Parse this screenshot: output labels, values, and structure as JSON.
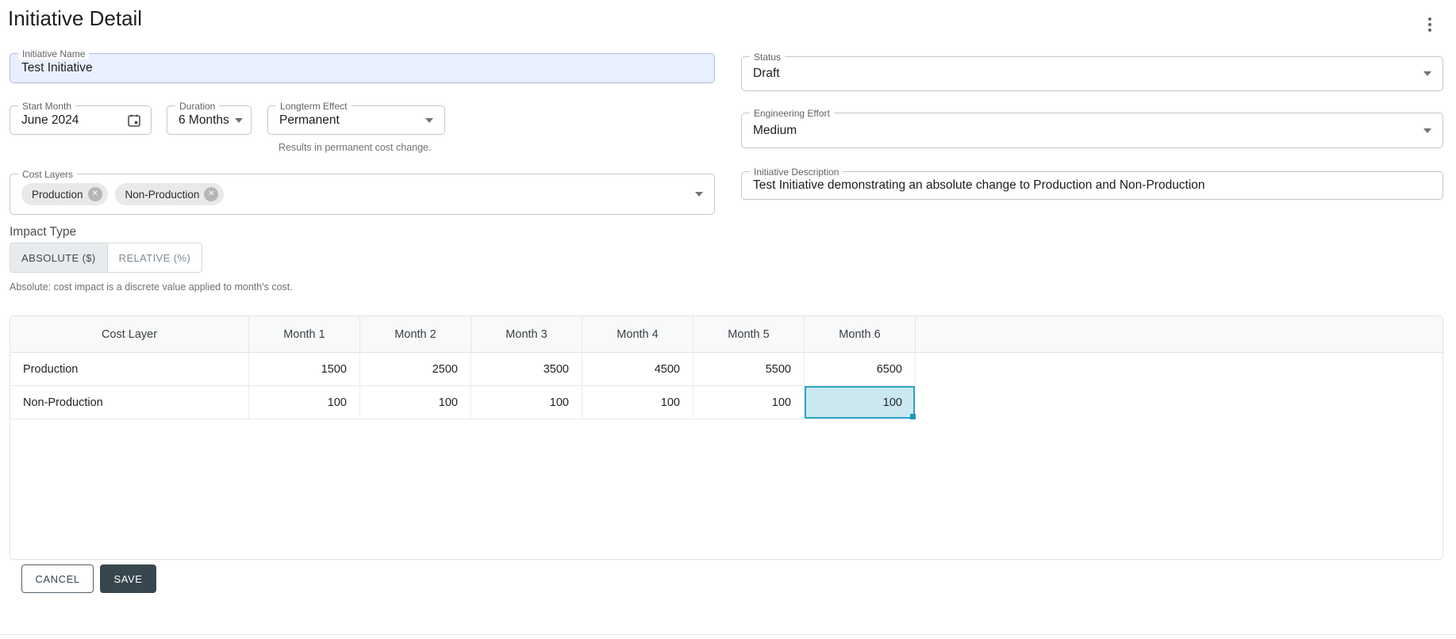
{
  "header": {
    "title": "Initiative Detail"
  },
  "fields": {
    "initiative_name": {
      "label": "Initiative Name",
      "value": "Test Initiative"
    },
    "status": {
      "label": "Status",
      "value": "Draft"
    },
    "start_month": {
      "label": "Start Month",
      "value": "June 2024"
    },
    "duration": {
      "label": "Duration",
      "value": "6 Months"
    },
    "longterm_effect": {
      "label": "Longterm Effect",
      "value": "Permanent",
      "helper": "Results in permanent cost change."
    },
    "engineering_effort": {
      "label": "Engineering Effort",
      "value": "Medium"
    },
    "cost_layers": {
      "label": "Cost Layers",
      "chips": [
        {
          "label": "Production"
        },
        {
          "label": "Non-Production"
        }
      ]
    },
    "initiative_description": {
      "label": "Initiative Description",
      "value": "Test Initiative demonstrating an absolute change to Production and Non-Production"
    }
  },
  "impact_type": {
    "label": "Impact Type",
    "options": [
      {
        "label": "ABSOLUTE ($)",
        "selected": true
      },
      {
        "label": "RELATIVE (%)",
        "selected": false
      }
    ],
    "helper": "Absolute: cost impact is a discrete value applied to month's cost."
  },
  "table": {
    "columns": [
      "Cost Layer",
      "Month 1",
      "Month 2",
      "Month 3",
      "Month 4",
      "Month 5",
      "Month 6"
    ],
    "rows": [
      {
        "layer": "Production",
        "values": [
          1500,
          2500,
          3500,
          4500,
          5500,
          6500
        ]
      },
      {
        "layer": "Non-Production",
        "values": [
          100,
          100,
          100,
          100,
          100,
          100
        ]
      }
    ],
    "selected_cell": {
      "row": "Non-Production",
      "column": "Month 6",
      "value": 100
    }
  },
  "actions": {
    "cancel": "CANCEL",
    "save": "SAVE"
  },
  "colors": {
    "accent_dark": "#37474f",
    "selected_cell_bg": "#cbe8f1",
    "selected_cell_border": "#2ba5c6",
    "autofill_bg": "#e8f0fe",
    "chip_bg": "#e9e9ea"
  }
}
